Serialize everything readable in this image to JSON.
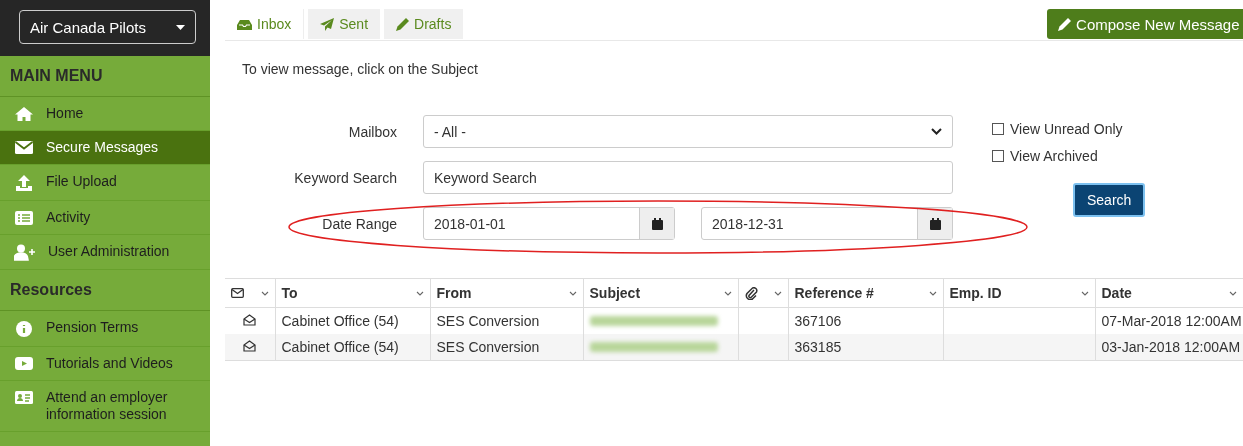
{
  "sidebar": {
    "account_select": {
      "value": "Air Canada Pilots"
    },
    "sections": [
      {
        "title": "MAIN MENU",
        "items": [
          {
            "label": "Home",
            "kind": "home",
            "selected": false
          },
          {
            "label": "Secure Messages",
            "kind": "envelope",
            "selected": true
          },
          {
            "label": "File Upload",
            "kind": "upload",
            "selected": false
          },
          {
            "label": "Activity",
            "kind": "list",
            "selected": false
          },
          {
            "label": "User Administration",
            "kind": "user-plus",
            "selected": false
          }
        ]
      },
      {
        "title": "Resources",
        "items": [
          {
            "label": "Pension Terms",
            "kind": "info",
            "selected": false
          },
          {
            "label": "Tutorials and Videos",
            "kind": "play",
            "selected": false
          },
          {
            "label": "Attend an employer information session",
            "kind": "card",
            "selected": false
          }
        ]
      }
    ]
  },
  "tabs": [
    {
      "label": "Inbox",
      "kind": "inbox",
      "selected": true
    },
    {
      "label": "Sent",
      "kind": "send",
      "selected": false
    },
    {
      "label": "Drafts",
      "kind": "pencil",
      "selected": false
    }
  ],
  "compose_button": {
    "label": "Compose New Message"
  },
  "instruction": "To view message, click on the Subject",
  "filters": {
    "mailbox": {
      "label": "Mailbox",
      "value": "- All -"
    },
    "keyword": {
      "label": "Keyword Search",
      "placeholder": "Keyword Search"
    },
    "date_range": {
      "label": "Date Range",
      "from": "2018-01-01",
      "to": "2018-12-31",
      "annotated": true
    },
    "checkboxes": [
      {
        "label": "View Unread Only",
        "checked": false
      },
      {
        "label": "View Archived",
        "checked": false
      }
    ],
    "search_button": "Search"
  },
  "table": {
    "columns": [
      {
        "kind": "envelope"
      },
      {
        "label": "To"
      },
      {
        "label": "From"
      },
      {
        "label": "Subject"
      },
      {
        "kind": "paperclip"
      },
      {
        "label": "Reference #"
      },
      {
        "label": "Emp. ID"
      },
      {
        "label": "Date"
      }
    ],
    "rows": [
      {
        "to": "Cabinet Office (54)",
        "from": "SES Conversion",
        "subject_redacted": true,
        "reference": "367106",
        "date": "07-Mar-2018 12:00AM"
      },
      {
        "to": "Cabinet Office (54)",
        "from": "SES Conversion",
        "subject_redacted": true,
        "reference": "363185",
        "date": "03-Jan-2018 12:00AM"
      }
    ]
  }
}
